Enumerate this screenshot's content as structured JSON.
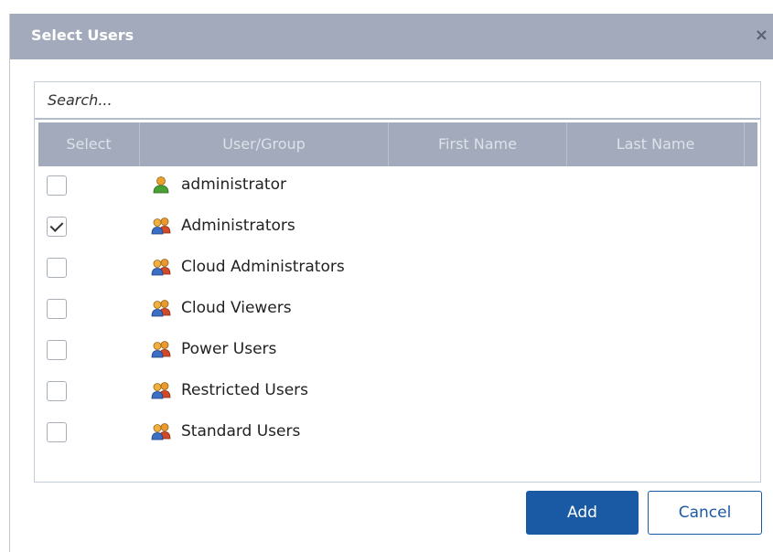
{
  "dialog": {
    "title": "Select Users",
    "close_glyph": "×",
    "search_placeholder": "Search...",
    "columns": [
      "Select",
      "User/Group",
      "First Name",
      "Last Name"
    ],
    "rows": [
      {
        "name": "administrator",
        "kind": "user",
        "checked": false
      },
      {
        "name": "Administrators",
        "kind": "group",
        "checked": true
      },
      {
        "name": "Cloud Administrators",
        "kind": "group",
        "checked": false
      },
      {
        "name": "Cloud Viewers",
        "kind": "group",
        "checked": false
      },
      {
        "name": "Power Users",
        "kind": "group",
        "checked": false
      },
      {
        "name": "Restricted Users",
        "kind": "group",
        "checked": false
      },
      {
        "name": "Standard Users",
        "kind": "group",
        "checked": false
      }
    ],
    "add_label": "Add",
    "cancel_label": "Cancel"
  },
  "colors": {
    "titlebar": "#a2aabb",
    "primary": "#1a5aa5"
  }
}
